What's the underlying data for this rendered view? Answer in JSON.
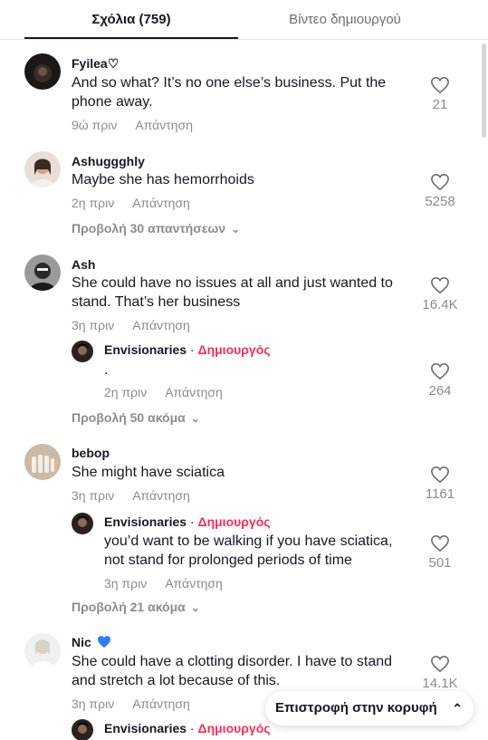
{
  "tabs": {
    "comments": "Σχόλια (759)",
    "creator_videos": "Βίντεο δημιουργού"
  },
  "comments": [
    {
      "username": "Fyilea♡",
      "text": "And so what? It’s no one else’s business. Put the phone away.",
      "time": "9ώ πριν",
      "reply": "Απάντηση",
      "likes": "21"
    },
    {
      "username": "Ashuggghly",
      "text": "Maybe she has hemorrhoids",
      "time": "2η πριν",
      "reply": "Απάντηση",
      "likes": "5258",
      "view_replies": "Προβολή 30 απαντήσεων"
    },
    {
      "username": "Ash",
      "text": "She could have no issues at all and just wanted to stand. That’s her business",
      "time": "3η πριν",
      "reply": "Απάντηση",
      "likes": "16.4K",
      "creator_reply": {
        "username": "Envisionaries",
        "sep": " · ",
        "tag": "Δημιουργός",
        "text": ".",
        "time": "2η πριν",
        "reply": "Απάντηση",
        "likes": "264"
      },
      "view_more": "Προβολή 50 ακόμα"
    },
    {
      "username": "bebop",
      "text": "She might have sciatica",
      "time": "3η πριν",
      "reply": "Απάντηση",
      "likes": "1161",
      "creator_reply": {
        "username": "Envisionaries",
        "sep": " · ",
        "tag": "Δημιουργός",
        "text": "you’d want to be walking if you have sciatica, not stand for prolonged periods of time",
        "time": "3η πριν",
        "reply": "Απάντηση",
        "likes": "501"
      },
      "view_more": "Προβολή 21 ακόμα"
    },
    {
      "username": "Nic",
      "text": "She could have a clotting disorder. I have to stand and stretch a lot because of this.",
      "time": "3η πριν",
      "reply": "Απάντηση",
      "likes": "14.1K",
      "creator_reply": {
        "username": "Envisionaries",
        "sep": " · ",
        "tag": "Δημιουργός"
      }
    }
  ],
  "back_to_top": "Επιστροφή στην κορυφή",
  "colors": {
    "creator_tag": "#fe2c55",
    "muted": "#8a8b91",
    "verified": "#2b7cff"
  }
}
